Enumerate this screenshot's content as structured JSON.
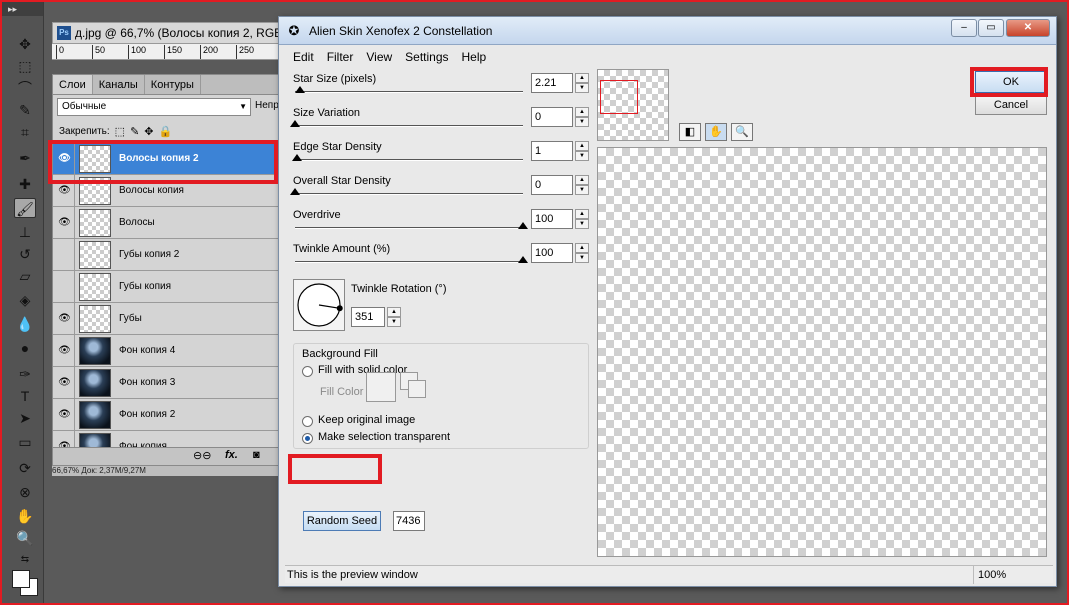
{
  "photoshop": {
    "document_tab": "д.jpg @ 66,7% (Волосы копия 2, RGB/",
    "ps_badge": "Ps",
    "ruler_marks": [
      "0",
      "50",
      "100",
      "150",
      "200",
      "250"
    ],
    "layers_panel": {
      "tabs": [
        "Слои",
        "Каналы",
        "Контуры"
      ],
      "blend_mode": "Обычные",
      "opacity_label": "Непр",
      "lock_label": "Закрепить:",
      "layers": [
        {
          "name": "Волосы копия 2",
          "visible": true,
          "selected": true,
          "thumb": "transparent"
        },
        {
          "name": "Волосы копия",
          "visible": true,
          "selected": false,
          "thumb": "transparent"
        },
        {
          "name": "Волосы",
          "visible": true,
          "selected": false,
          "thumb": "transparent"
        },
        {
          "name": "Губы копия 2",
          "visible": false,
          "selected": false,
          "thumb": "transparent"
        },
        {
          "name": "Губы копия",
          "visible": false,
          "selected": false,
          "thumb": "transparent"
        },
        {
          "name": "Губы",
          "visible": true,
          "selected": false,
          "thumb": "transparent"
        },
        {
          "name": "Фон копия 4",
          "visible": true,
          "selected": false,
          "thumb": "photo"
        },
        {
          "name": "Фон копия 3",
          "visible": true,
          "selected": false,
          "thumb": "photo"
        },
        {
          "name": "Фон копия 2",
          "visible": true,
          "selected": false,
          "thumb": "photo"
        },
        {
          "name": "Фон копия",
          "visible": true,
          "selected": false,
          "thumb": "photo"
        }
      ],
      "footer_icons": [
        "link-icon",
        "fx-icon",
        "mask-icon"
      ]
    },
    "status_text": "66,67%      Док: 2,37M/9,27M"
  },
  "dialog": {
    "title": "Alien Skin Xenofex 2 Constellation",
    "menu": [
      "Edit",
      "Filter",
      "View",
      "Settings",
      "Help"
    ],
    "sliders": [
      {
        "label": "Star Size (pixels)",
        "value": "2.21",
        "fraction": 0.02
      },
      {
        "label": "Size Variation",
        "value": "0",
        "fraction": 0.0
      },
      {
        "label": "Edge Star Density",
        "value": "1",
        "fraction": 0.01
      },
      {
        "label": "Overall Star Density",
        "value": "0",
        "fraction": 0.0
      },
      {
        "label": "Overdrive",
        "value": "100",
        "fraction": 1.0
      },
      {
        "label": "Twinkle Amount (%)",
        "value": "100",
        "fraction": 1.0
      }
    ],
    "twinkle_rotation": {
      "label": "Twinkle Rotation (°)",
      "value": "351",
      "degrees": 351
    },
    "background_fill": {
      "title": "Background Fill",
      "options": [
        {
          "label": "Fill with solid color",
          "checked": false
        },
        {
          "label": "Keep original image",
          "checked": false
        },
        {
          "label": "Make selection transparent",
          "checked": true
        }
      ],
      "fill_color_label": "Fill Color"
    },
    "random_seed": {
      "label": "Random Seed",
      "value": "7436"
    },
    "buttons": {
      "ok": "OK",
      "cancel": "Cancel"
    },
    "status": {
      "message": "This is the preview window",
      "zoom": "100%"
    }
  },
  "colors": {
    "highlight": "#e21b22",
    "selection": "#3c83d6"
  }
}
